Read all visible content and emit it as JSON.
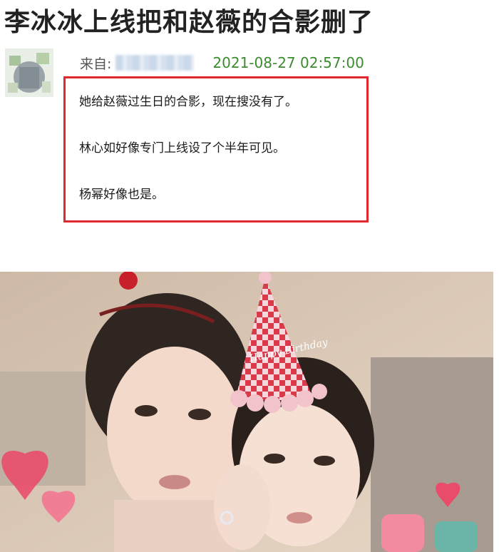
{
  "post": {
    "title": "李冰冰上线把和赵薇的合影删了",
    "from_label": "来自:",
    "timestamp": "2021-08-27 02:57:00",
    "lines": [
      "她给赵薇过生日的合影，现在搜没有了。",
      "林心如好像专门上线设了个半年可见。",
      "杨幂好像也是。"
    ]
  },
  "photo": {
    "hat_text": "Happy Birthday"
  },
  "colors": {
    "highlight_box": "#e0282d",
    "timestamp": "#3b8c2e"
  }
}
